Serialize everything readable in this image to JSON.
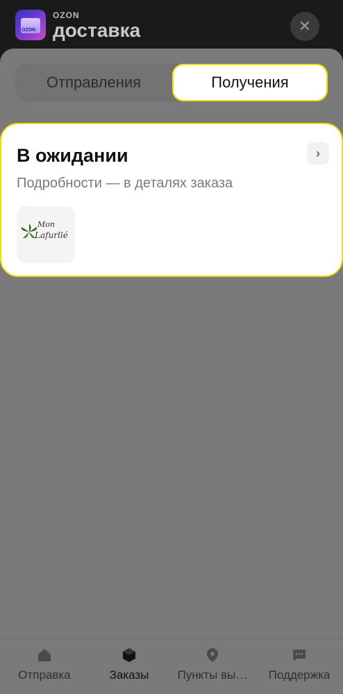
{
  "header": {
    "brand_small": "OZON",
    "brand_big": "доставка",
    "app_icon_label": "OZON"
  },
  "tabs": [
    {
      "label": "Отправления",
      "active": false
    },
    {
      "label": "Получения",
      "active": true
    }
  ],
  "order_card": {
    "title": "В ожидании",
    "subtitle": "Подробности — в деталях заказа",
    "thumbnail_line1": "Mon",
    "thumbnail_line2": "Lafurllé"
  },
  "bottom_nav": [
    {
      "label": "Отправка",
      "icon": "home-icon",
      "active": false
    },
    {
      "label": "Заказы",
      "icon": "box-icon",
      "active": true
    },
    {
      "label": "Пункты вы…",
      "icon": "location-pin-icon",
      "active": false
    },
    {
      "label": "Поддержка",
      "icon": "chat-icon",
      "active": false
    }
  ],
  "colors": {
    "accent_yellow": "#f2e100",
    "overlay": "#7a7a7a",
    "topbar": "#1a1a1a"
  }
}
